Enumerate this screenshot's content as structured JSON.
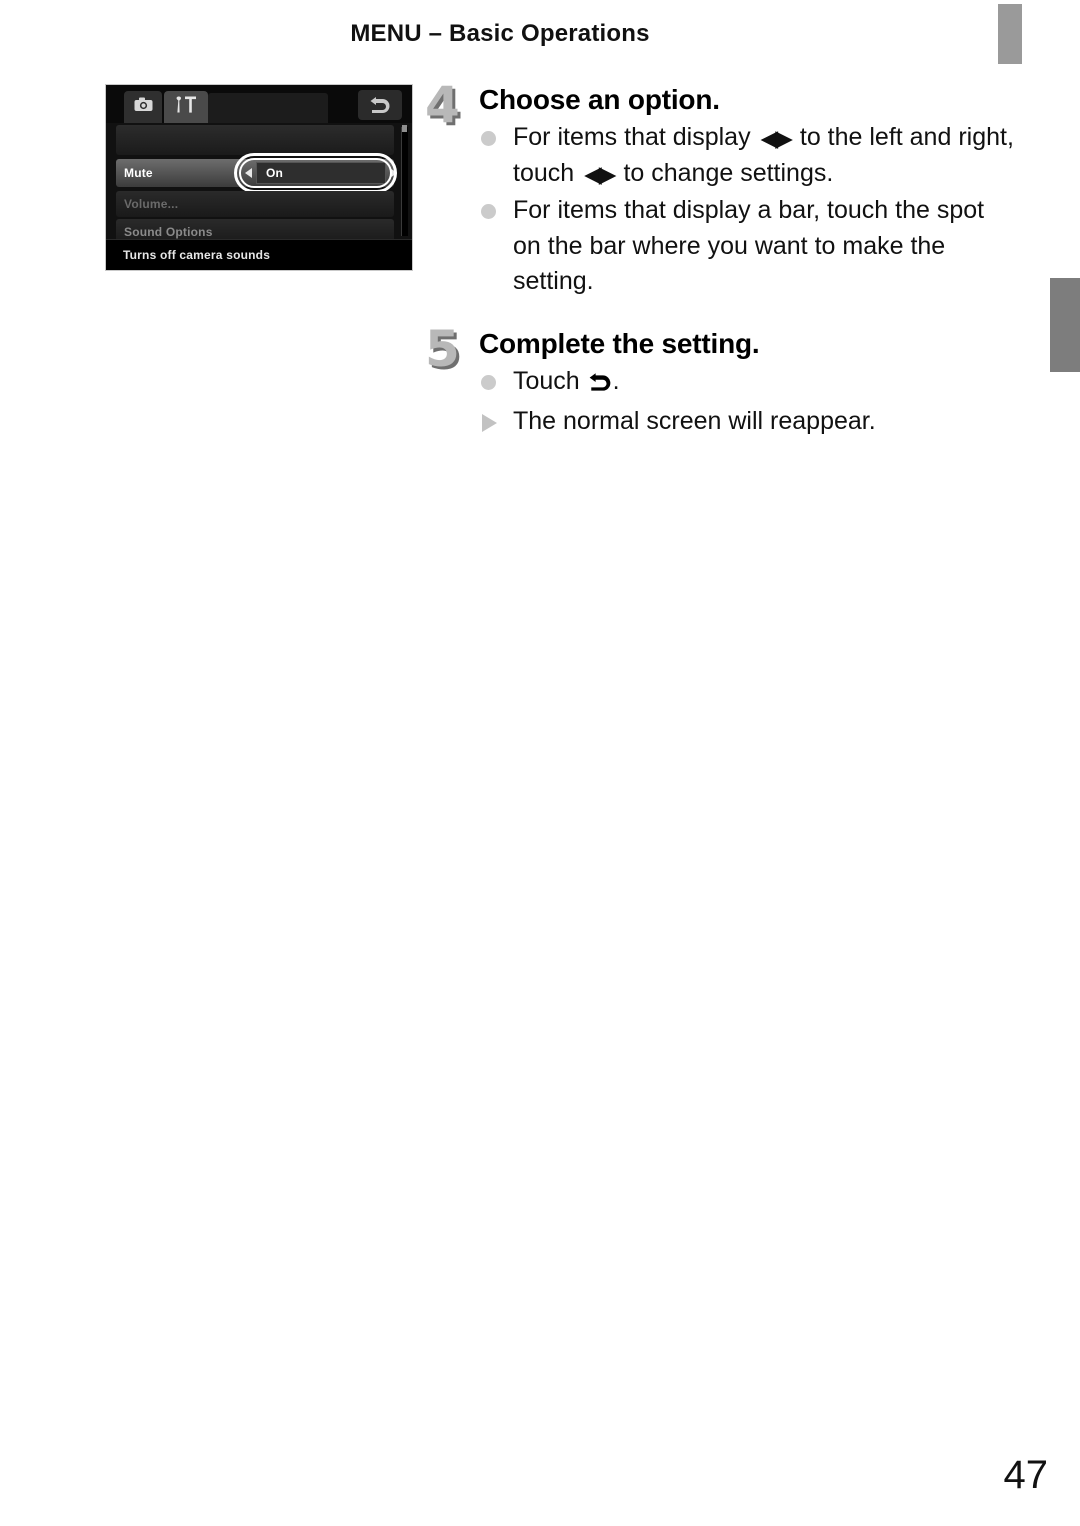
{
  "header": {
    "title": "MENU – Basic Operations"
  },
  "page_number": "47",
  "camera_screen": {
    "tabs": [
      {
        "icon": "camera-icon",
        "selected": false
      },
      {
        "icon": "tools-icon",
        "selected": true
      }
    ],
    "back_button_icon": "return-arrow-icon",
    "rows": [
      {
        "label": "Mute",
        "value": "On",
        "state": "selected"
      },
      {
        "label": "Volume...",
        "value": "",
        "state": "dimmed"
      },
      {
        "label": "Sound Options",
        "value": "",
        "state": "dimmed"
      }
    ],
    "left_arrow_icon": "left-triangle-icon",
    "right_arrow_icon": "right-triangle-icon",
    "hint": "Turns off camera sounds"
  },
  "steps": [
    {
      "number": "4",
      "title": "Choose an option.",
      "bullets": [
        {
          "marker": "dot",
          "parts": [
            {
              "type": "text",
              "value": "For items that display "
            },
            {
              "type": "glyph",
              "value": "◀▶"
            },
            {
              "type": "text",
              "value": " to the left and right, touch "
            },
            {
              "type": "glyph",
              "value": "◀▶"
            },
            {
              "type": "text",
              "value": " to change settings."
            }
          ]
        },
        {
          "marker": "dot",
          "parts": [
            {
              "type": "text",
              "value": "For items that display a bar, touch the spot on the bar where you want to make the setting."
            }
          ]
        }
      ]
    },
    {
      "number": "5",
      "title": "Complete the setting.",
      "bullets": [
        {
          "marker": "dot",
          "parts": [
            {
              "type": "text",
              "value": "Touch "
            },
            {
              "type": "icon",
              "value": "return-arrow-icon"
            },
            {
              "type": "text",
              "value": "."
            }
          ]
        },
        {
          "marker": "triangle",
          "parts": [
            {
              "type": "text",
              "value": "The normal screen will reappear."
            }
          ]
        }
      ]
    }
  ],
  "markers": {
    "top_tab_color": "#9a9a9a",
    "side_tab_color": "#7d7d7d"
  }
}
